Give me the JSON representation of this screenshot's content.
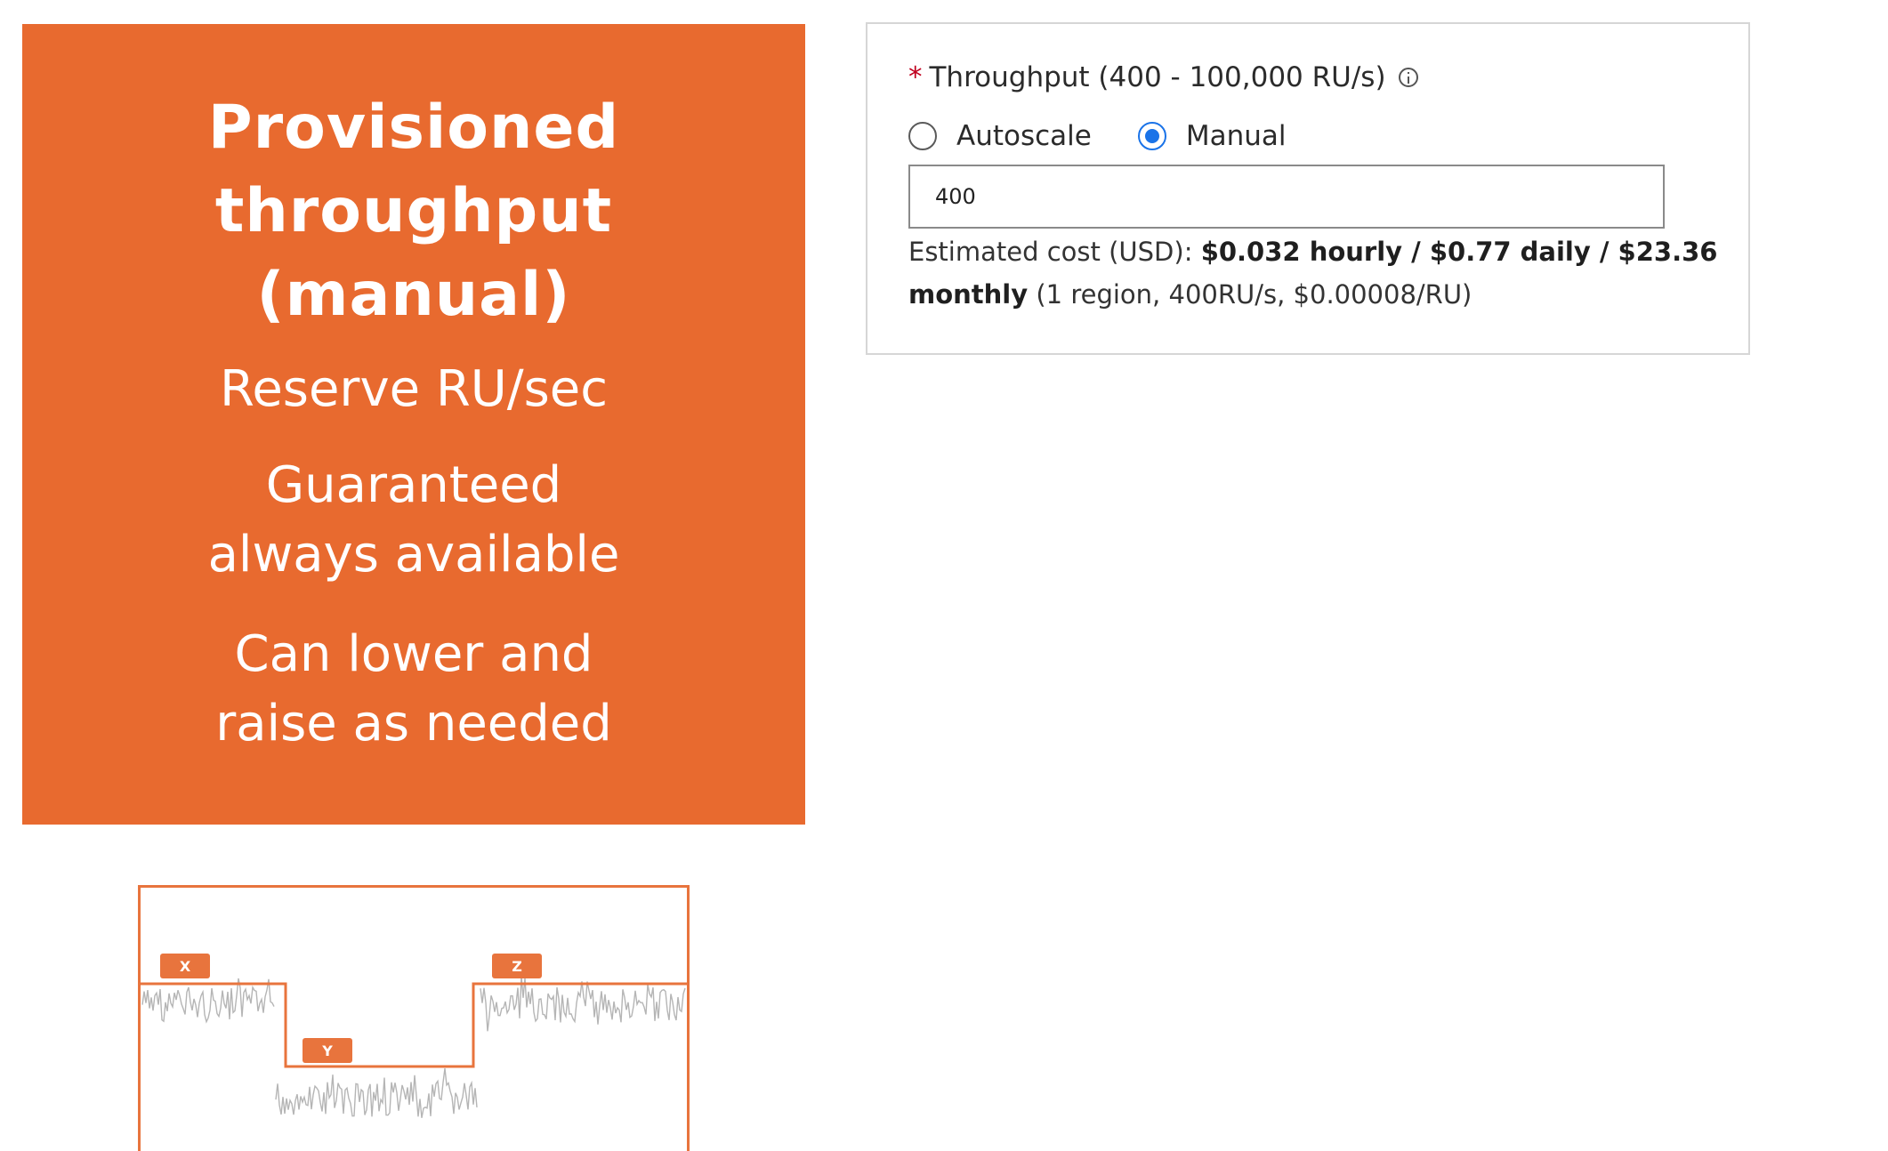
{
  "slide": {
    "title_lines": [
      "Provisioned",
      "throughput",
      "(manual)"
    ],
    "point1": "Reserve RU/sec",
    "point2_lines": [
      "Guaranteed",
      "always available"
    ],
    "point3_lines": [
      "Can lower and",
      "raise as needed"
    ],
    "background_color": "#e86a2f"
  },
  "diagram": {
    "tags": [
      "X",
      "Y",
      "Z"
    ],
    "accent_color": "#e8743d"
  },
  "throughput": {
    "required_mark": "*",
    "label": "Throughput (400 - 100,000 RU/s)",
    "info_icon": "info-icon",
    "options": [
      {
        "label": "Autoscale",
        "selected": false
      },
      {
        "label": "Manual",
        "selected": true
      }
    ],
    "value": "400",
    "cost_prefix": "Estimated cost (USD): ",
    "cost_bold": "$0.032 hourly / $0.77 daily / $23.36 monthly",
    "cost_suffix": " (1 region, 400RU/s, $0.00008/RU)"
  }
}
